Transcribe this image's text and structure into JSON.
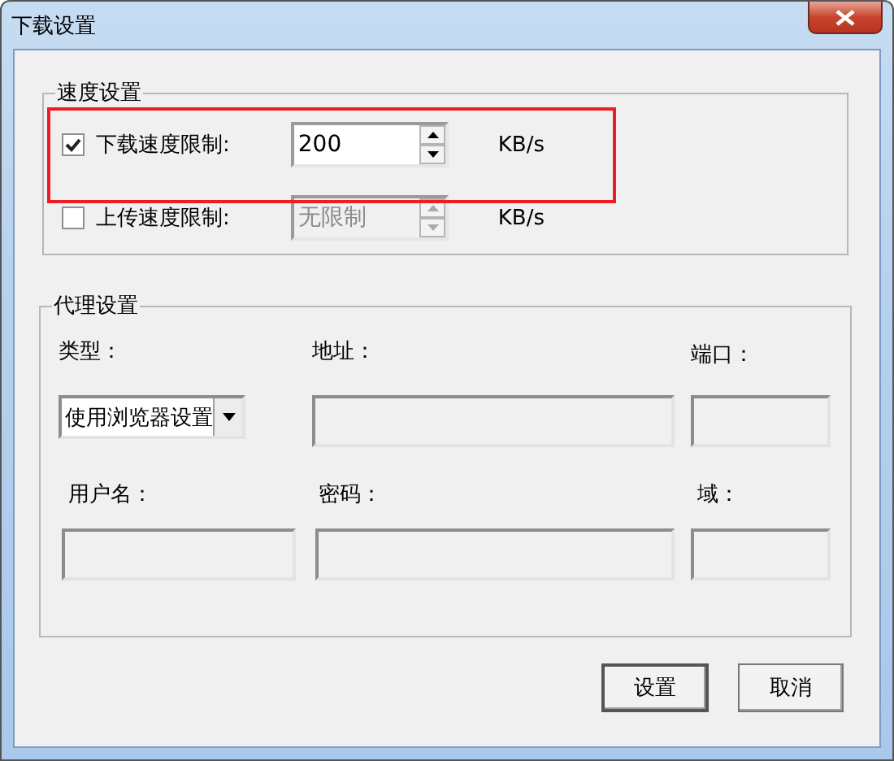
{
  "window": {
    "title": "下载设置"
  },
  "speed_group": {
    "title": "速度设置",
    "rows": [
      {
        "label": "下载速度限制:",
        "checked": true,
        "value": "200",
        "unit": "KB/s",
        "disabled": false
      },
      {
        "label": "上传速度限制:",
        "checked": false,
        "value": "无限制",
        "unit": "KB/s",
        "disabled": true
      }
    ]
  },
  "proxy_group": {
    "title": "代理设置",
    "fields": [
      {
        "label": "类型：",
        "kind": "dropdown",
        "value": "使用浏览器设置"
      },
      {
        "label": "地址：",
        "kind": "text"
      },
      {
        "label": "端口：",
        "kind": "text"
      },
      {
        "label": "用户名：",
        "kind": "text"
      },
      {
        "label": "密码：",
        "kind": "text"
      },
      {
        "label": "域：",
        "kind": "text"
      }
    ]
  },
  "buttons": [
    {
      "label": "设置",
      "default": true
    },
    {
      "label": "取消",
      "default": false
    }
  ]
}
